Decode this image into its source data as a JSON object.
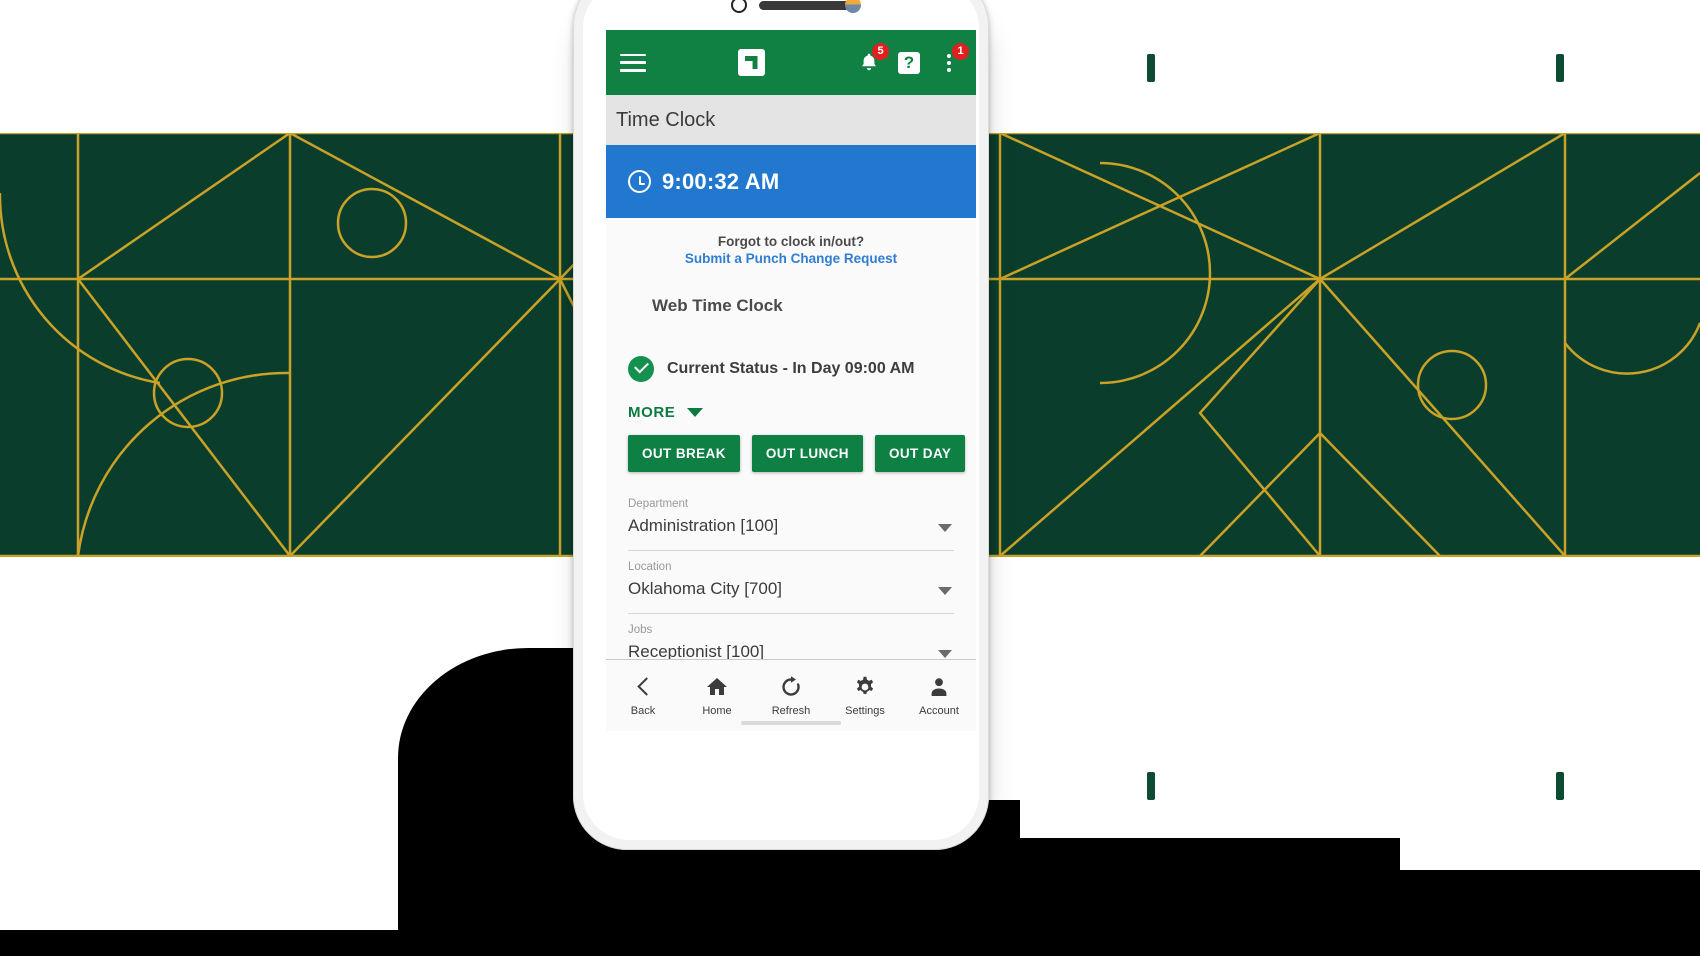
{
  "app": {
    "brand_color": "#108043",
    "accent_blue": "#2278cf",
    "badge_color": "#e02020"
  },
  "appbar": {
    "menu_icon": "hamburger-menu-icon",
    "logo_icon": "paycom-logo-icon",
    "notifications": {
      "icon": "bell-icon",
      "badge": "5"
    },
    "help": {
      "icon": "question-mark-icon",
      "label": "?"
    },
    "overflow": {
      "icon": "kebab-menu-icon",
      "badge": "1"
    }
  },
  "page": {
    "title": "Time Clock"
  },
  "clock": {
    "icon": "clock-icon",
    "time": "9:00:32 AM"
  },
  "forgot": {
    "question": "Forgot to clock in/out?",
    "link": "Submit a Punch Change Request"
  },
  "section": {
    "web_time_clock": "Web Time Clock"
  },
  "status": {
    "icon": "check-circle-icon",
    "text": "Current Status - In Day 09:00 AM"
  },
  "more": {
    "label": "MORE",
    "icon": "chevron-down-icon"
  },
  "actions": [
    {
      "label": "OUT BREAK"
    },
    {
      "label": "OUT LUNCH"
    },
    {
      "label": "OUT DAY"
    }
  ],
  "fields": [
    {
      "label": "Department",
      "value": "Administration [100]",
      "icon": "dropdown-arrow-icon"
    },
    {
      "label": "Location",
      "value": "Oklahoma City [700]",
      "icon": "dropdown-arrow-icon"
    },
    {
      "label": "Jobs",
      "value": "Receptionist [100]",
      "icon": "dropdown-arrow-icon"
    }
  ],
  "bottom_nav": [
    {
      "label": "Back",
      "icon": "chevron-left-icon"
    },
    {
      "label": "Home",
      "icon": "home-icon"
    },
    {
      "label": "Refresh",
      "icon": "refresh-icon"
    },
    {
      "label": "Settings",
      "icon": "gear-icon"
    },
    {
      "label": "Account",
      "icon": "person-icon"
    }
  ]
}
